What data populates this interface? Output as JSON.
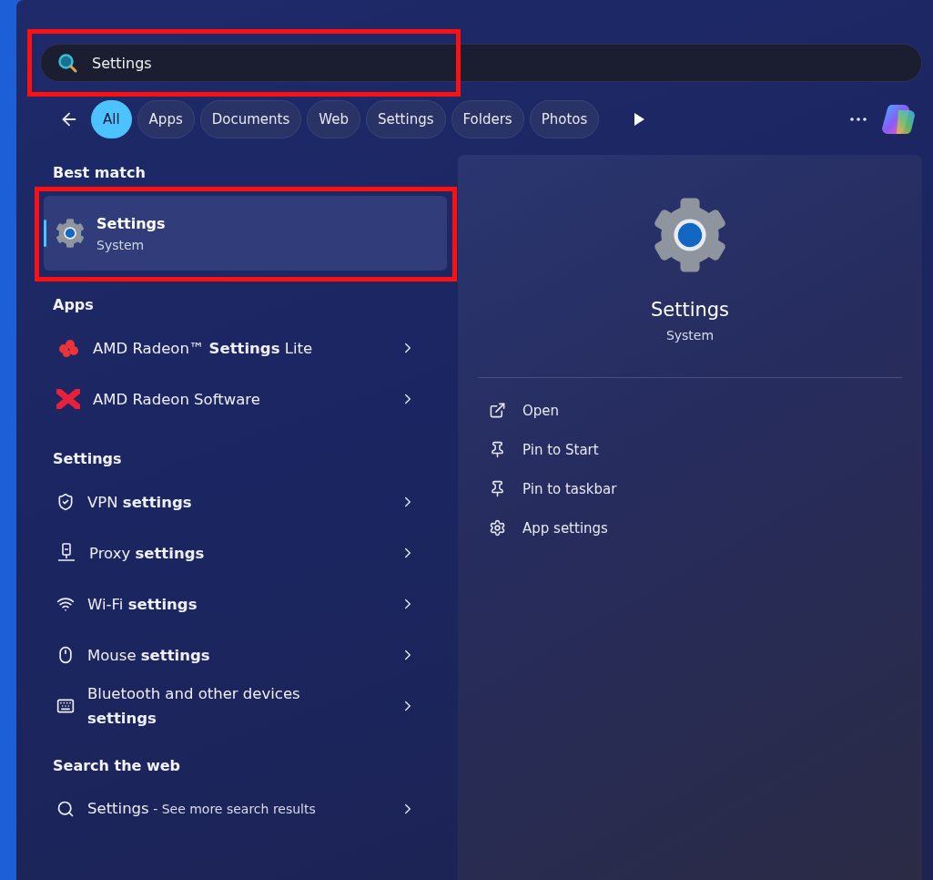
{
  "search": {
    "value": "Settings",
    "highlighted": true
  },
  "filters": [
    {
      "label": "All",
      "selected": true
    },
    {
      "label": "Apps",
      "selected": false
    },
    {
      "label": "Documents",
      "selected": false
    },
    {
      "label": "Web",
      "selected": false
    },
    {
      "label": "Settings",
      "selected": false
    },
    {
      "label": "Folders",
      "selected": false
    },
    {
      "label": "Photos",
      "selected": false
    }
  ],
  "best_match": {
    "heading": "Best match",
    "title": "Settings",
    "subtitle": "System",
    "selected": true,
    "highlighted": true
  },
  "sections": [
    {
      "heading": "Apps",
      "items": [
        {
          "kind": "amd-lite",
          "label": "AMD Radeon™ **Settings** Lite"
        },
        {
          "kind": "amd",
          "label": "AMD Radeon Software"
        }
      ]
    },
    {
      "heading": "Settings",
      "items": [
        {
          "kind": "vpn",
          "label": "VPN **settings**"
        },
        {
          "kind": "proxy",
          "label": "Proxy **settings**"
        },
        {
          "kind": "wifi",
          "label": "Wi-Fi **settings**"
        },
        {
          "kind": "mouse",
          "label": "Mouse **settings**"
        },
        {
          "kind": "bluetooth",
          "label": "Bluetooth and other devices **settings**"
        }
      ]
    },
    {
      "heading": "Search the web",
      "items": [
        {
          "kind": "web",
          "label": "Settings",
          "suffix": "- See more search results"
        }
      ]
    }
  ],
  "detail": {
    "title": "Settings",
    "subtitle": "System",
    "actions": [
      {
        "kind": "open",
        "label": "Open"
      },
      {
        "kind": "pin",
        "label": "Pin to Start"
      },
      {
        "kind": "pin",
        "label": "Pin to taskbar"
      },
      {
        "kind": "gear",
        "label": "App settings"
      }
    ]
  }
}
